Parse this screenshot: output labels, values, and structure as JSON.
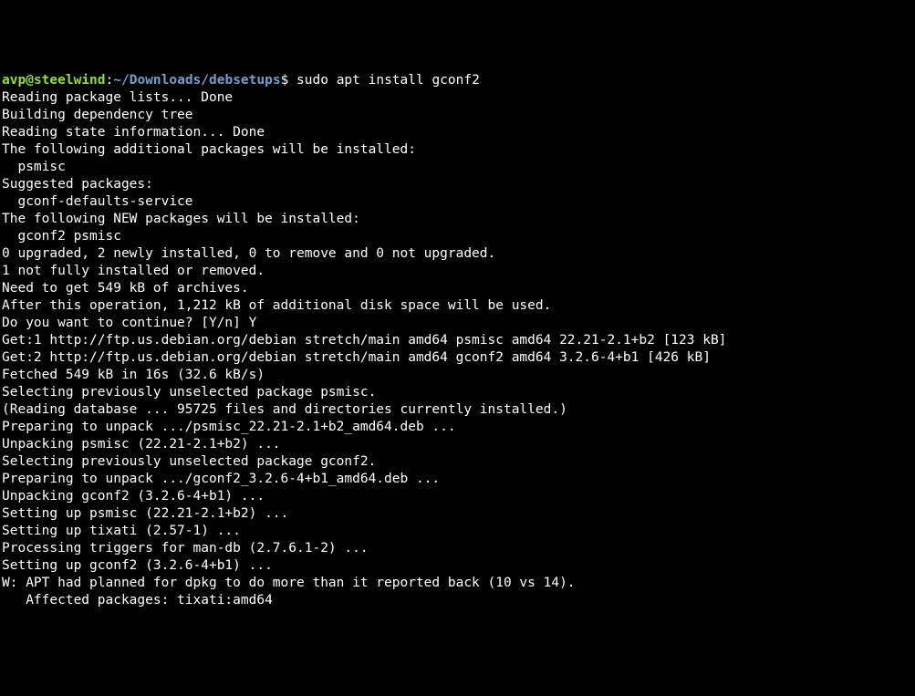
{
  "prompt": {
    "user": "avp",
    "at": "@",
    "host": "steelwind",
    "colon": ":",
    "path": "~/Downloads/debsetups",
    "dollar": "$",
    "command": "sudo apt install gconf2"
  },
  "lines": [
    "Reading package lists... Done",
    "Building dependency tree",
    "Reading state information... Done",
    "The following additional packages will be installed:",
    "  psmisc",
    "Suggested packages:",
    "  gconf-defaults-service",
    "The following NEW packages will be installed:",
    "  gconf2 psmisc",
    "0 upgraded, 2 newly installed, 0 to remove and 0 not upgraded.",
    "1 not fully installed or removed.",
    "Need to get 549 kB of archives.",
    "After this operation, 1,212 kB of additional disk space will be used.",
    "Do you want to continue? [Y/n] Y",
    "Get:1 http://ftp.us.debian.org/debian stretch/main amd64 psmisc amd64 22.21-2.1+b2 [123 kB]",
    "Get:2 http://ftp.us.debian.org/debian stretch/main amd64 gconf2 amd64 3.2.6-4+b1 [426 kB]",
    "Fetched 549 kB in 16s (32.6 kB/s)",
    "Selecting previously unselected package psmisc.",
    "(Reading database ... 95725 files and directories currently installed.)",
    "Preparing to unpack .../psmisc_22.21-2.1+b2_amd64.deb ...",
    "Unpacking psmisc (22.21-2.1+b2) ...",
    "Selecting previously unselected package gconf2.",
    "Preparing to unpack .../gconf2_3.2.6-4+b1_amd64.deb ...",
    "Unpacking gconf2 (3.2.6-4+b1) ...",
    "Setting up psmisc (22.21-2.1+b2) ...",
    "Setting up tixati (2.57-1) ...",
    "Processing triggers for man-db (2.7.6.1-2) ...",
    "Setting up gconf2 (3.2.6-4+b1) ...",
    "W: APT had planned for dpkg to do more than it reported back (10 vs 14).",
    "   Affected packages: tixati:amd64"
  ]
}
